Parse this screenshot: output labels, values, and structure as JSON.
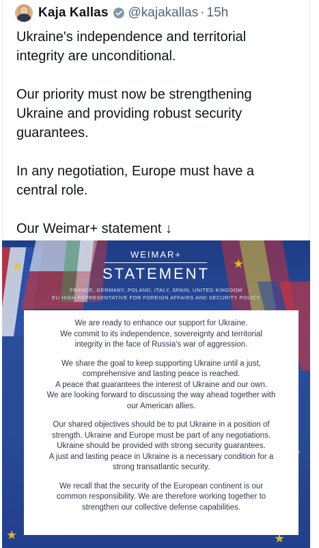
{
  "tweet": {
    "display_name": "Kaja Kallas",
    "handle": "@kajakallas",
    "separator": "·",
    "timestamp": "15h",
    "text": "Ukraine's independence and territorial\nintegrity are unconditional.\n\nOur priority must now be strengthening\nUkraine and providing robust security\nguarantees.\n\nIn any negotiation, Europe must have a\ncentral role.\n\nOur Weimar+ statement ↓"
  },
  "media": {
    "weimar_label": "WEIMAR+",
    "title": "STATEMENT",
    "countries": "FRANCE, GERMANY, POLAND, ITALY, SPAIN, UNITED KINGDOM",
    "representative": "EU HIGH REPRESENTATIVE FOR FOREIGN AFFAIRS AND SECURITY POLICY",
    "paragraphs": [
      "We are ready to enhance our support for Ukraine.\nWe commit to its independence, sovereignty and territorial\nintegrity in the face of Russia's war of aggression.",
      "We share the goal to keep supporting Ukraine until a just,\ncomprehensive and lasting peace is reached.\nA peace that guarantees the interest of Ukraine and our own.\nWe are looking forward to discussing the way ahead together with\nour American allies.",
      "Our shared objectives should be to put Ukraine in a position of\nstrength. Ukraine and Europe must be part of any negotiations.\nUkraine should be provided with strong security guarantees.\nA just and lasting peace in Ukraine is a necessary condition for a\nstrong transatlantic security.",
      "We recall that the security of the European continent is our\ncommon responsibility. We are therefore working together to\nstrengthen our collective defense capabilities."
    ]
  }
}
